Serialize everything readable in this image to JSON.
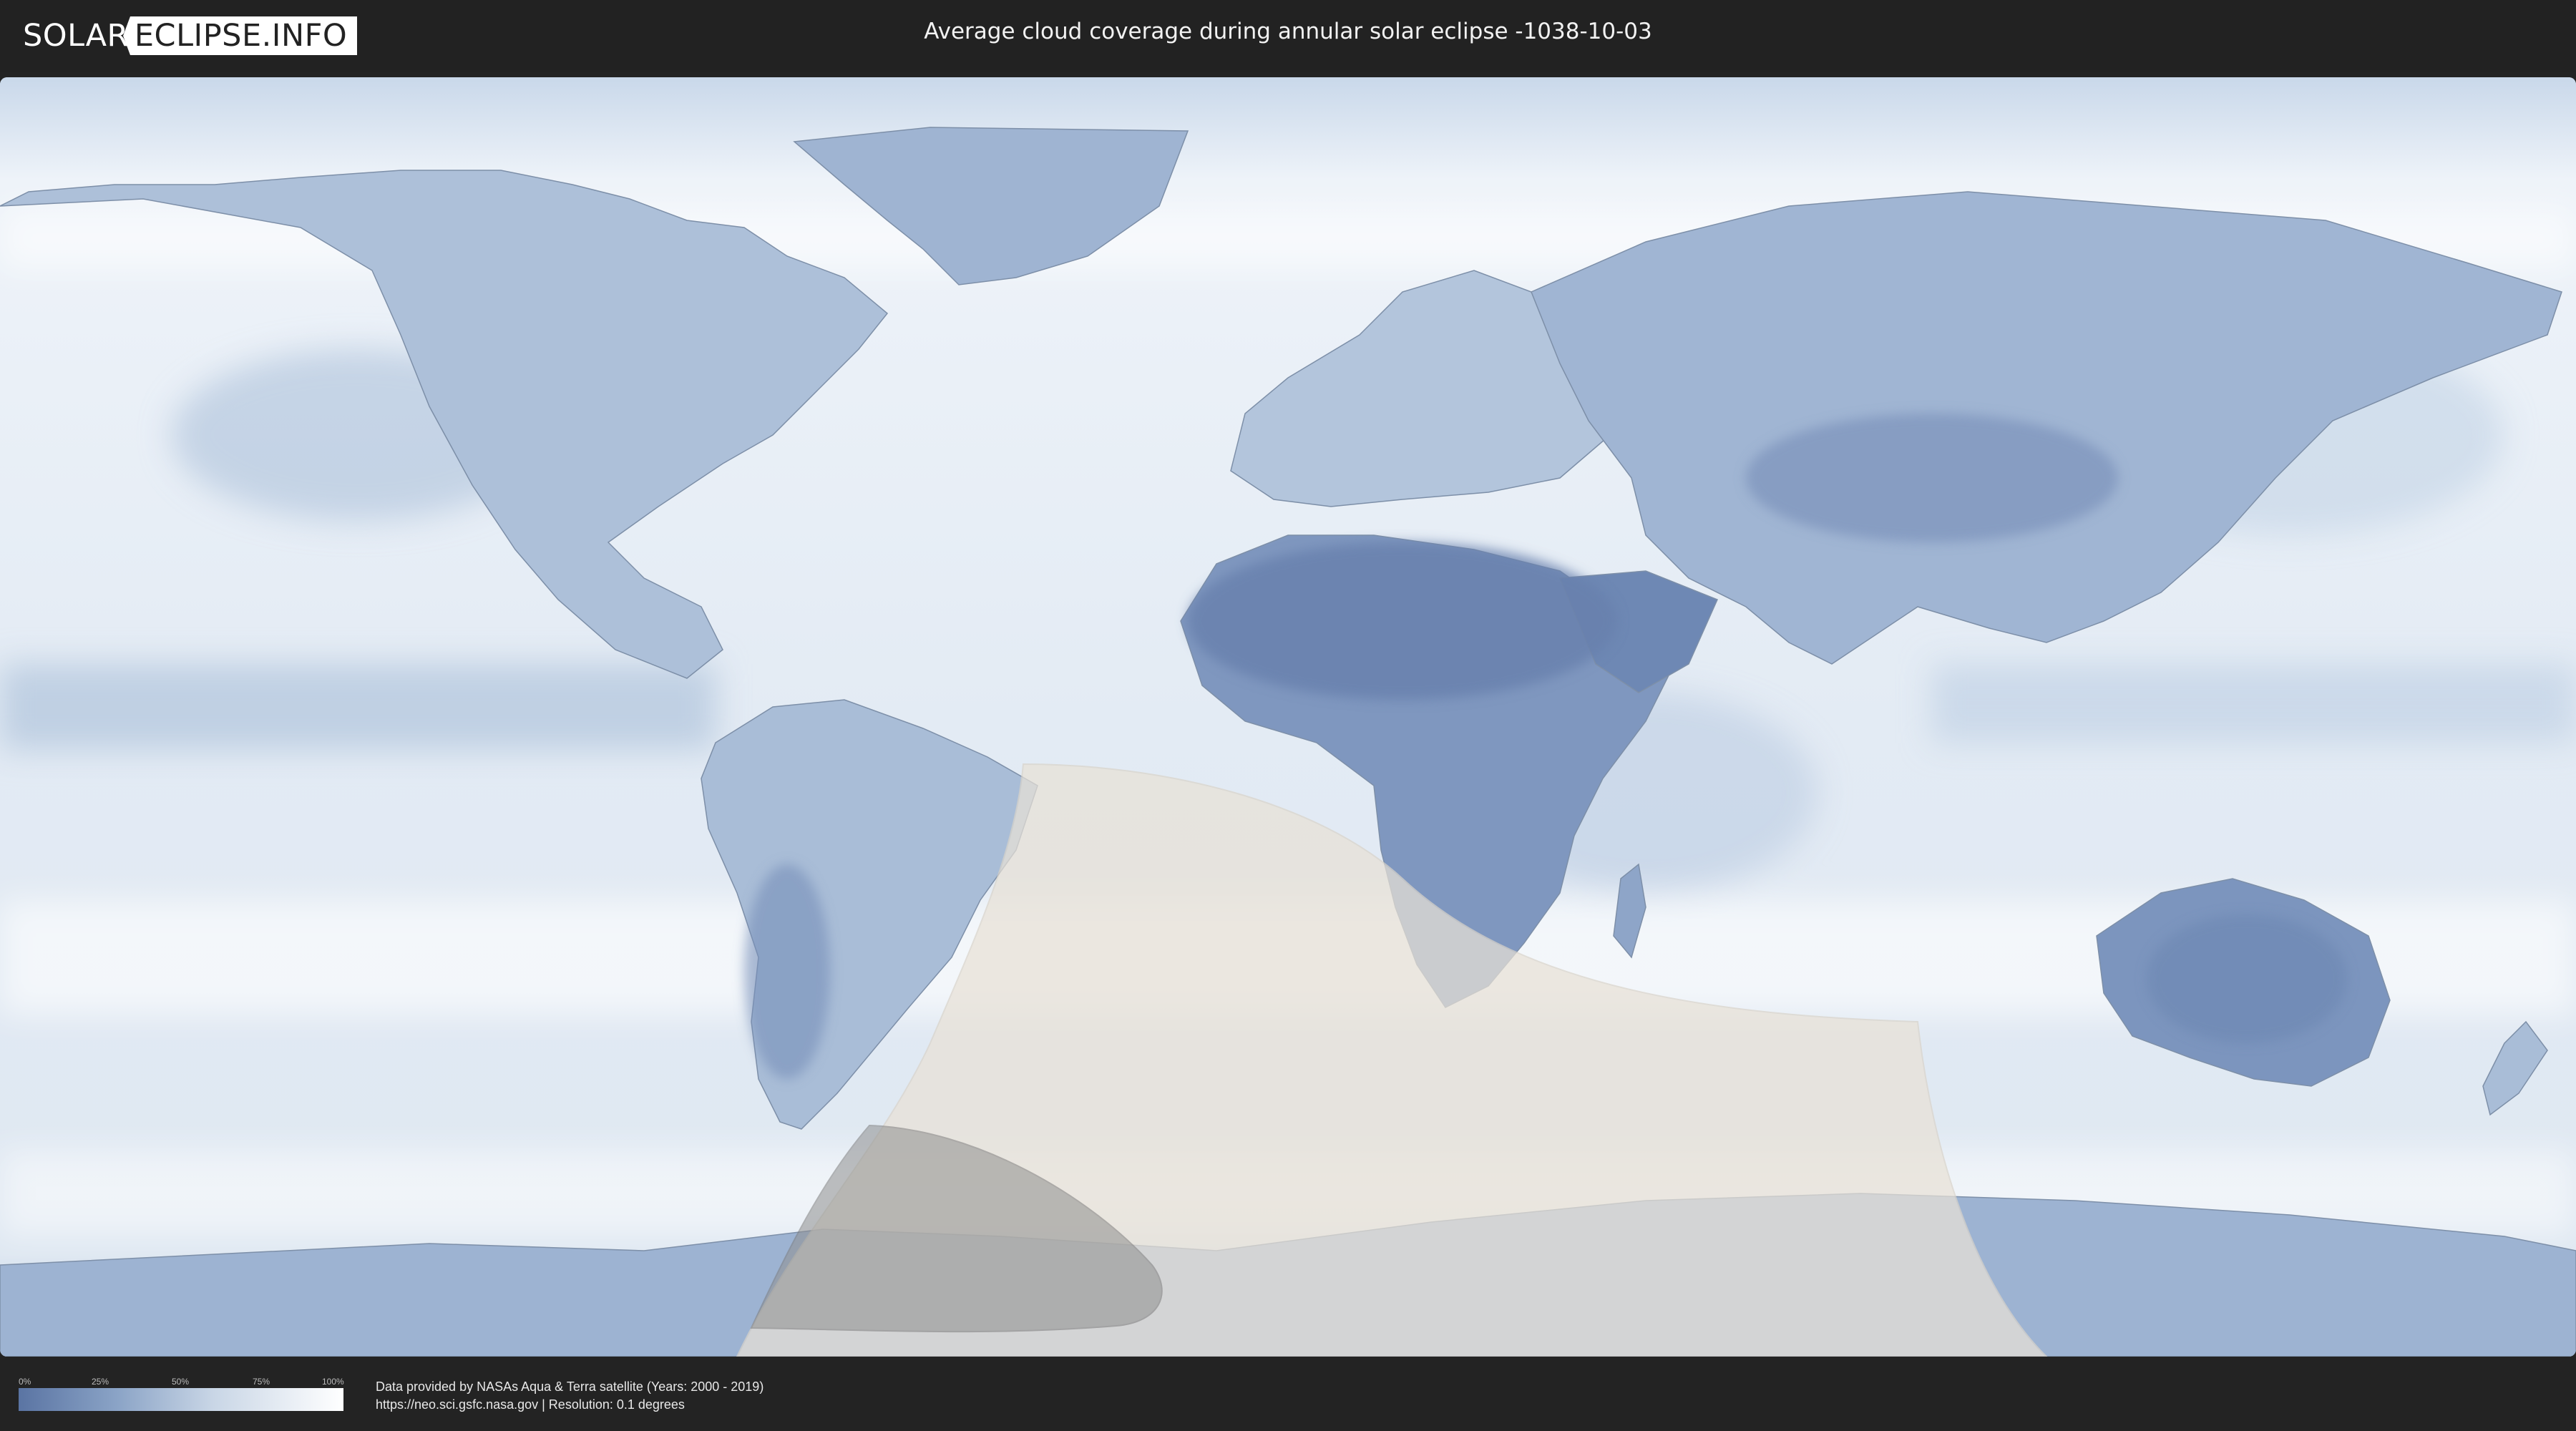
{
  "header": {
    "logo_left": "SOLAR",
    "logo_right": "ECLIPSE.INFO",
    "title": "Average cloud coverage during annular solar eclipse -1038-10-03"
  },
  "map": {
    "colors": {
      "cloud": "#f4f7fb",
      "clear_sky": "#5f7aa8",
      "mid": "#a9bdd7",
      "eclipse_overlay": "#e8e1d6",
      "annular_path": "#8f8f8f",
      "coastline": "#6d7f97"
    }
  },
  "legend": {
    "ticks": [
      "0%",
      "25%",
      "50%",
      "75%",
      "100%"
    ],
    "tick_values": [
      0,
      25,
      50,
      75,
      100
    ]
  },
  "credits": {
    "line1": "Data provided by NASAs Aqua & Terra satellite (Years: 2000 - 2019)",
    "line2": "https://neo.sci.gsfc.nasa.gov | Resolution: 0.1 degrees"
  }
}
